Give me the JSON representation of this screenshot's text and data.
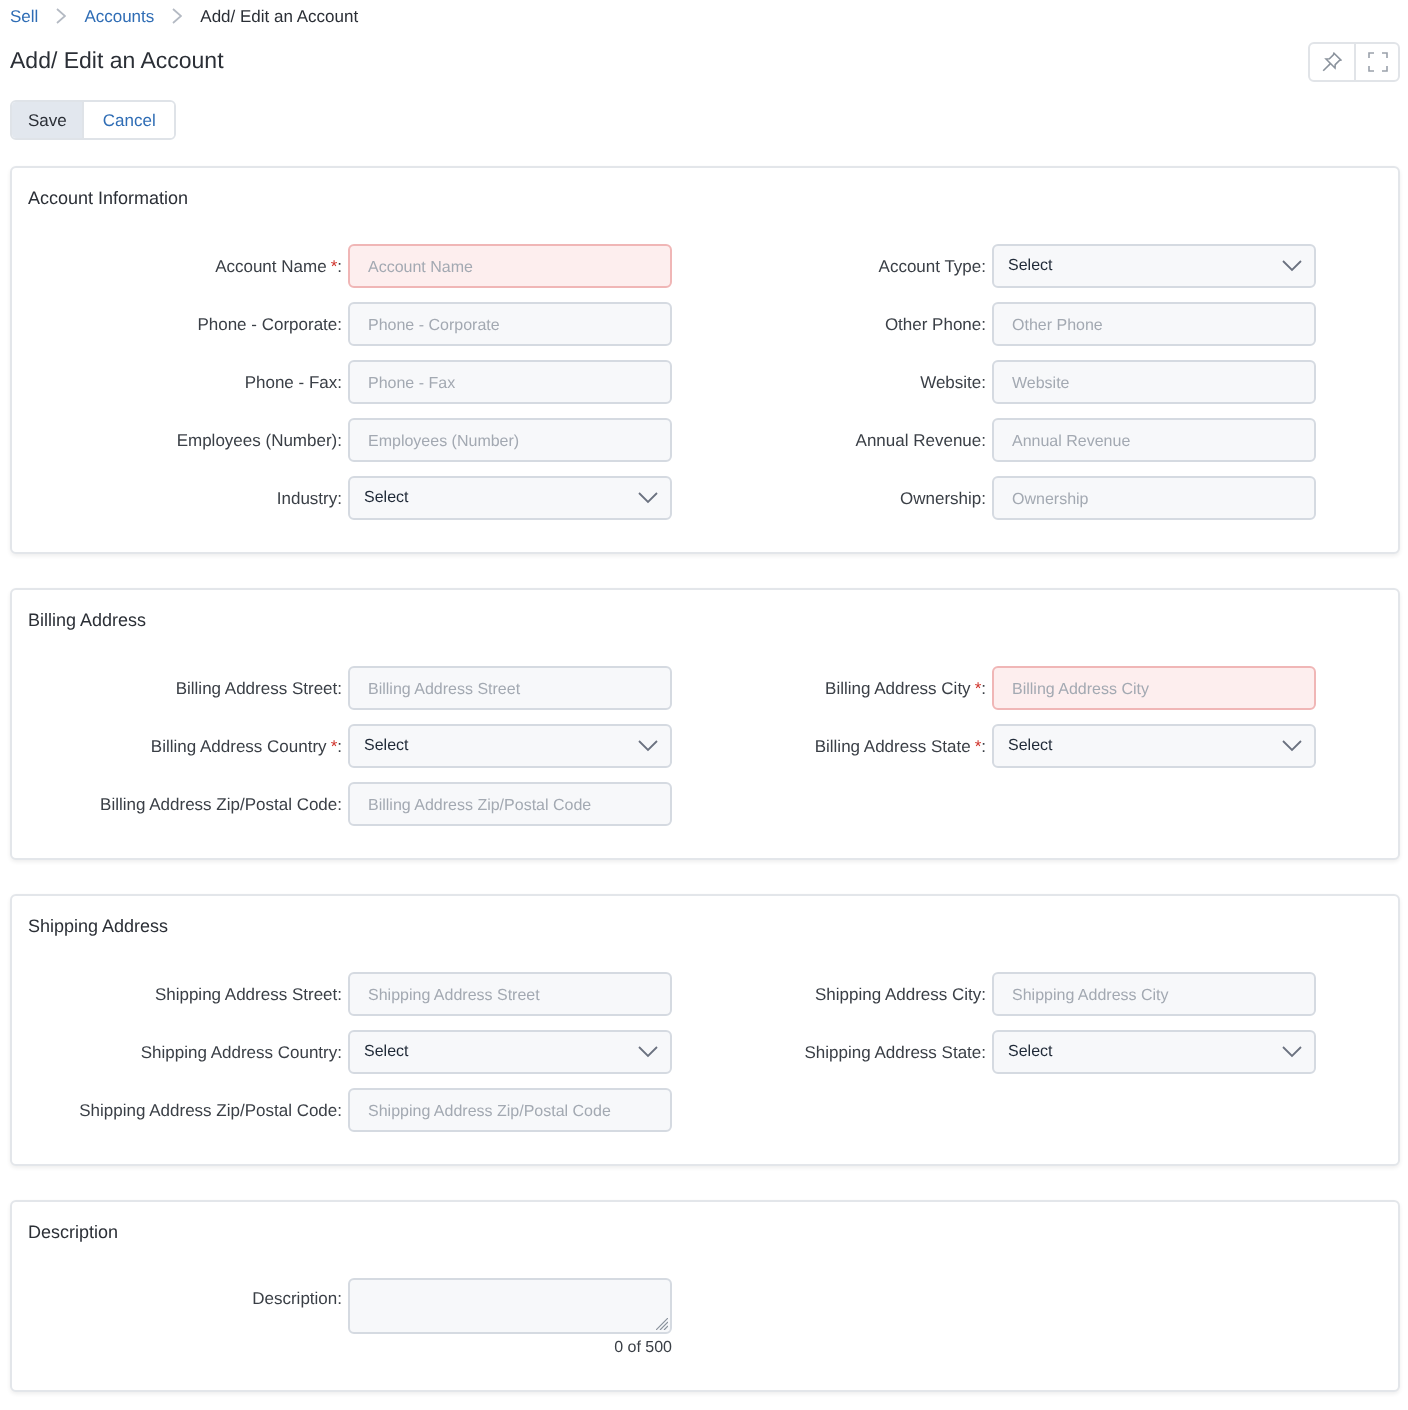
{
  "breadcrumb": [
    {
      "label": "Sell",
      "link": true
    },
    {
      "label": "Accounts",
      "link": true
    },
    {
      "label": "Add/ Edit an Account",
      "link": false
    }
  ],
  "title": "Add/ Edit an Account",
  "buttons": [
    {
      "label": "Save",
      "kind": "primary"
    },
    {
      "label": "Cancel",
      "kind": "secondary"
    }
  ],
  "sections": [
    {
      "title": "Account Information",
      "fields": [
        {
          "label": "Account Name",
          "required_mark": "*",
          "label_end": ":",
          "kind": "text",
          "placeholder": "Account Name",
          "invalid": true
        },
        {
          "label": "Account Type:",
          "kind": "select",
          "value": "Select",
          "invalid": false
        },
        {
          "label": "Phone - Corporate:",
          "kind": "text",
          "placeholder": "Phone - Corporate",
          "invalid": false
        },
        {
          "label": "Other Phone:",
          "kind": "text",
          "placeholder": "Other Phone",
          "invalid": false
        },
        {
          "label": "Phone - Fax:",
          "kind": "text",
          "placeholder": "Phone - Fax",
          "invalid": false
        },
        {
          "label": "Website:",
          "kind": "text",
          "placeholder": "Website",
          "invalid": false
        },
        {
          "label": "Employees (Number):",
          "kind": "text",
          "placeholder": "Employees (Number)",
          "invalid": false
        },
        {
          "label": "Annual Revenue:",
          "kind": "text",
          "placeholder": "Annual Revenue",
          "invalid": false
        },
        {
          "label": "Industry:",
          "kind": "select",
          "value": "Select",
          "invalid": false
        },
        {
          "label": "Ownership:",
          "kind": "text",
          "placeholder": "Ownership",
          "invalid": false
        }
      ]
    },
    {
      "title": "Billing Address",
      "fields": [
        {
          "label": "Billing Address Street:",
          "kind": "text",
          "placeholder": "Billing Address Street",
          "invalid": false
        },
        {
          "label": "Billing Address City",
          "required_mark": "*",
          "label_end": ":",
          "kind": "text",
          "placeholder": "Billing Address City",
          "invalid": true
        },
        {
          "label": "Billing Address Country",
          "required_mark": "*",
          "label_end": ":",
          "kind": "select",
          "value": "Select",
          "invalid": false
        },
        {
          "label": "Billing Address State",
          "required_mark": "*",
          "label_end": ":",
          "kind": "select",
          "value": "Select",
          "invalid": false
        },
        {
          "label": "Billing Address Zip/Postal Code:",
          "kind": "text",
          "placeholder": "Billing Address Zip/Postal Code",
          "invalid": false
        }
      ]
    },
    {
      "title": "Shipping Address",
      "fields": [
        {
          "label": "Shipping Address Street:",
          "kind": "text",
          "placeholder": "Shipping Address Street",
          "invalid": false
        },
        {
          "label": "Shipping Address City:",
          "kind": "text",
          "placeholder": "Shipping Address City",
          "invalid": false
        },
        {
          "label": "Shipping Address Country:",
          "kind": "select",
          "value": "Select",
          "invalid": false
        },
        {
          "label": "Shipping Address State:",
          "kind": "select",
          "value": "Select",
          "invalid": false
        },
        {
          "label": "Shipping Address Zip/Postal Code:",
          "kind": "text",
          "placeholder": "Shipping Address Zip/Postal Code",
          "invalid": false
        }
      ]
    },
    {
      "title": "Description",
      "fields": [
        {
          "label": "Description:",
          "kind": "textarea",
          "counter": "0 of 500",
          "invalid": false
        }
      ]
    }
  ]
}
